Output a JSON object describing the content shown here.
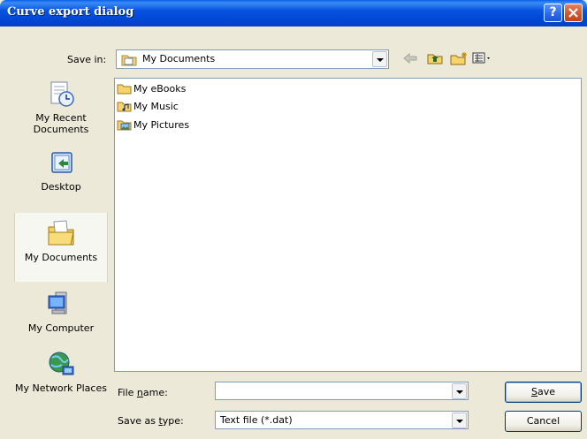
{
  "window": {
    "title": "Curve export dialog",
    "help_glyph": "?",
    "title_color": "#0a4fd8",
    "close_color": "#d4542a"
  },
  "toolbar": {
    "save_in_label": "Save in:",
    "save_in_value": "My Documents",
    "icons": [
      "back-arrow-icon",
      "up-folder-icon",
      "new-folder-icon",
      "views-menu-icon"
    ]
  },
  "places": [
    {
      "label": "My Recent Documents",
      "icon": "recent-documents-icon"
    },
    {
      "label": "Desktop",
      "icon": "desktop-icon"
    },
    {
      "label": "My Documents",
      "icon": "my-documents-icon",
      "selected": true
    },
    {
      "label": "My Computer",
      "icon": "my-computer-icon"
    },
    {
      "label": "My Network Places",
      "icon": "network-places-icon"
    }
  ],
  "files": [
    {
      "name": "My eBooks",
      "icon": "folder-icon"
    },
    {
      "name": "My Music",
      "icon": "music-folder-icon"
    },
    {
      "name": "My Pictures",
      "icon": "pictures-folder-icon"
    }
  ],
  "form": {
    "file_name_label_pre": "File ",
    "file_name_label_ul": "n",
    "file_name_label_post": "ame:",
    "file_name_value": "",
    "save_as_label_pre": "Save as ",
    "save_as_label_ul": "t",
    "save_as_label_post": "ype:",
    "save_as_value": "Text file (*.dat)"
  },
  "buttons": {
    "save_label_ul": "S",
    "save_label_rest": "ave",
    "cancel_label": "Cancel"
  }
}
